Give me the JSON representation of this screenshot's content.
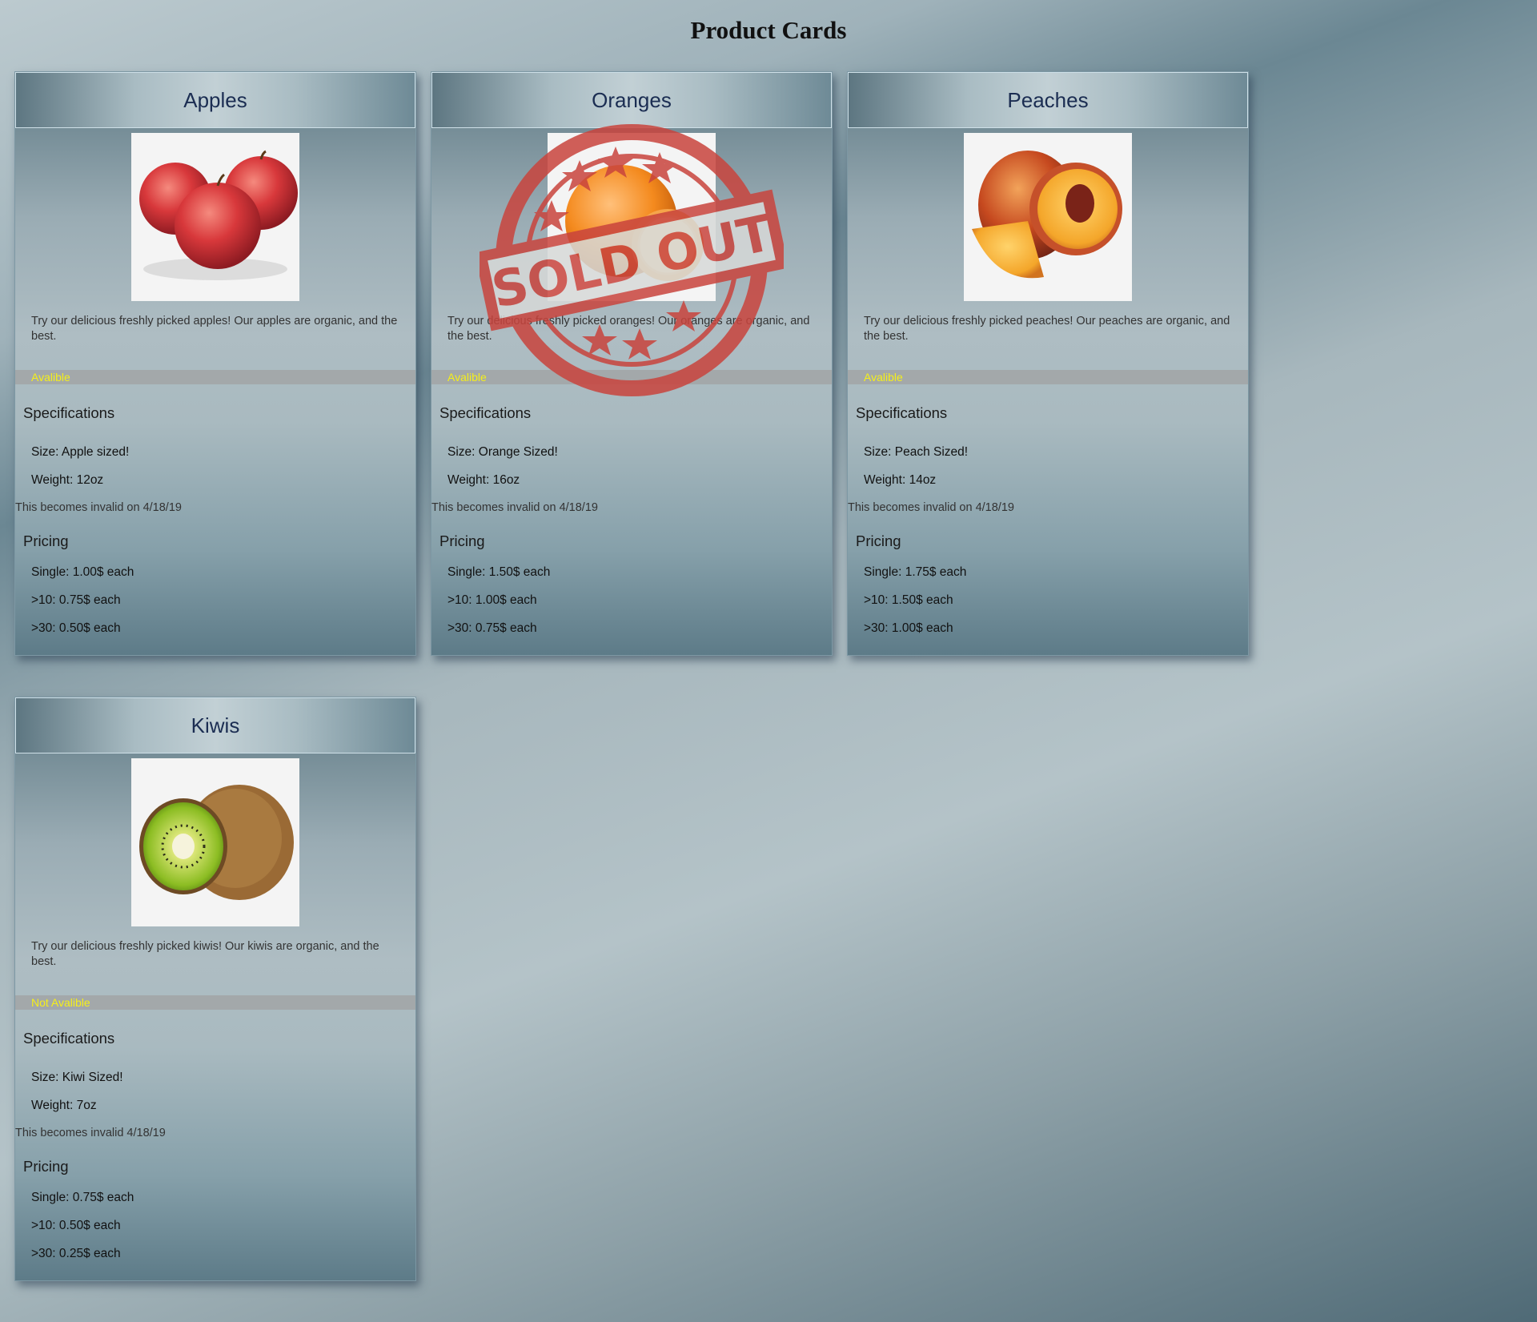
{
  "page_title": "Product Cards",
  "colors": {
    "status_text": "#f5ef1a",
    "title_text": "#1b2d52",
    "stamp_red": "#c9443d"
  },
  "cards": [
    {
      "title": "Apples",
      "image_icon": "apples-image",
      "description": "Try our delicious freshly picked apples! Our apples are organic, and the best.",
      "status": "Avalible",
      "spec_heading": "Specifications",
      "size": "Size: Apple sized!",
      "weight": "Weight: 12oz",
      "validity": "This becomes invalid on 4/18/19",
      "pricing_heading": "Pricing",
      "single": "Single: 1.00$ each",
      "over10": ">10: 0.75$ each",
      "over30": ">30: 0.50$ each"
    },
    {
      "title": "Oranges",
      "image_icon": "orange-image",
      "description": "Try our delicious freshly picked oranges! Our oranges are organic, and the best.",
      "status": "Avalible",
      "spec_heading": "Specifications",
      "size": "Size: Orange Sized!",
      "weight": "Weight: 16oz",
      "validity": "This becomes invalid on 4/18/19",
      "pricing_heading": "Pricing",
      "single": "Single: 1.50$ each",
      "over10": ">10: 1.00$ each",
      "over30": ">30: 0.75$ each",
      "stamp": "SOLD OUT"
    },
    {
      "title": "Peaches",
      "image_icon": "peaches-image",
      "description": "Try our delicious freshly picked peaches! Our peaches are organic, and the best.",
      "status": "Avalible",
      "spec_heading": "Specifications",
      "size": "Size: Peach Sized!",
      "weight": "Weight: 14oz",
      "validity": "This becomes invalid on 4/18/19",
      "pricing_heading": "Pricing",
      "single": "Single: 1.75$ each",
      "over10": ">10: 1.50$ each",
      "over30": ">30: 1.00$ each"
    },
    {
      "title": "Kiwis",
      "image_icon": "kiwi-image",
      "description": "Try our delicious freshly picked kiwis! Our kiwis are organic, and the best.",
      "status": "Not Avalible",
      "spec_heading": "Specifications",
      "size": "Size: Kiwi Sized!",
      "weight": "Weight: 7oz",
      "validity": "This becomes invalid 4/18/19",
      "pricing_heading": "Pricing",
      "single": "Single: 0.75$ each",
      "over10": ">10: 0.50$ each",
      "over30": ">30: 0.25$ each"
    }
  ]
}
